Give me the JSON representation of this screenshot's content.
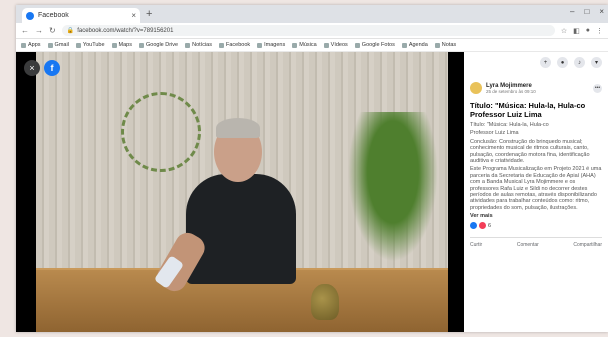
{
  "browser": {
    "tab_title": "Facebook",
    "tab_close": "×",
    "new_tab": "+",
    "window_controls": [
      "–",
      "□",
      "×"
    ],
    "url": "facebook.com/watch/?v=789156201",
    "bookmarks": [
      "Apps",
      "Gmail",
      "YouTube",
      "Maps",
      "Google Drive",
      "Notícias",
      "Facebook",
      "Imagens",
      "Música",
      "Vídeos",
      "Google Fotos",
      "Agenda",
      "Notas"
    ]
  },
  "video": {
    "close_icon": "×",
    "fb_logo": "f"
  },
  "post": {
    "author": "Lyra Mojimmere",
    "date": "25 de setembro às 09:10",
    "title_line1": "Título: \"Música: Hula-la, Hula-co",
    "title_line2": "Professor Luiz Lima",
    "text": [
      "Título: \"Música: Hula-la, Hula-co",
      "Professor Luiz Lima",
      "Conclusão: Construção do brinquedo musical; conhecimento musical de ritmos culturais, canto, pulsação, coordenação motora fina, identificação auditiva e criatividade.",
      "Este Programa Musicalização em Projeto 2021 é uma parceria da Secretaria de Educação de Apiaí (AHA) com a Banda Musical Lyra Mojimmere e os professores Rafa Luiz e Sildi no decorrer destes períodos de aulas remotas, através disponibilizando atividades para trabalhar conteúdos como: ritmo, propriedades do som, pulsação, ilustrações."
    ],
    "see_more": "Ver mais",
    "reactions_count": "6",
    "actions": [
      "Curtir",
      "Comentar",
      "Compartilhar"
    ]
  }
}
